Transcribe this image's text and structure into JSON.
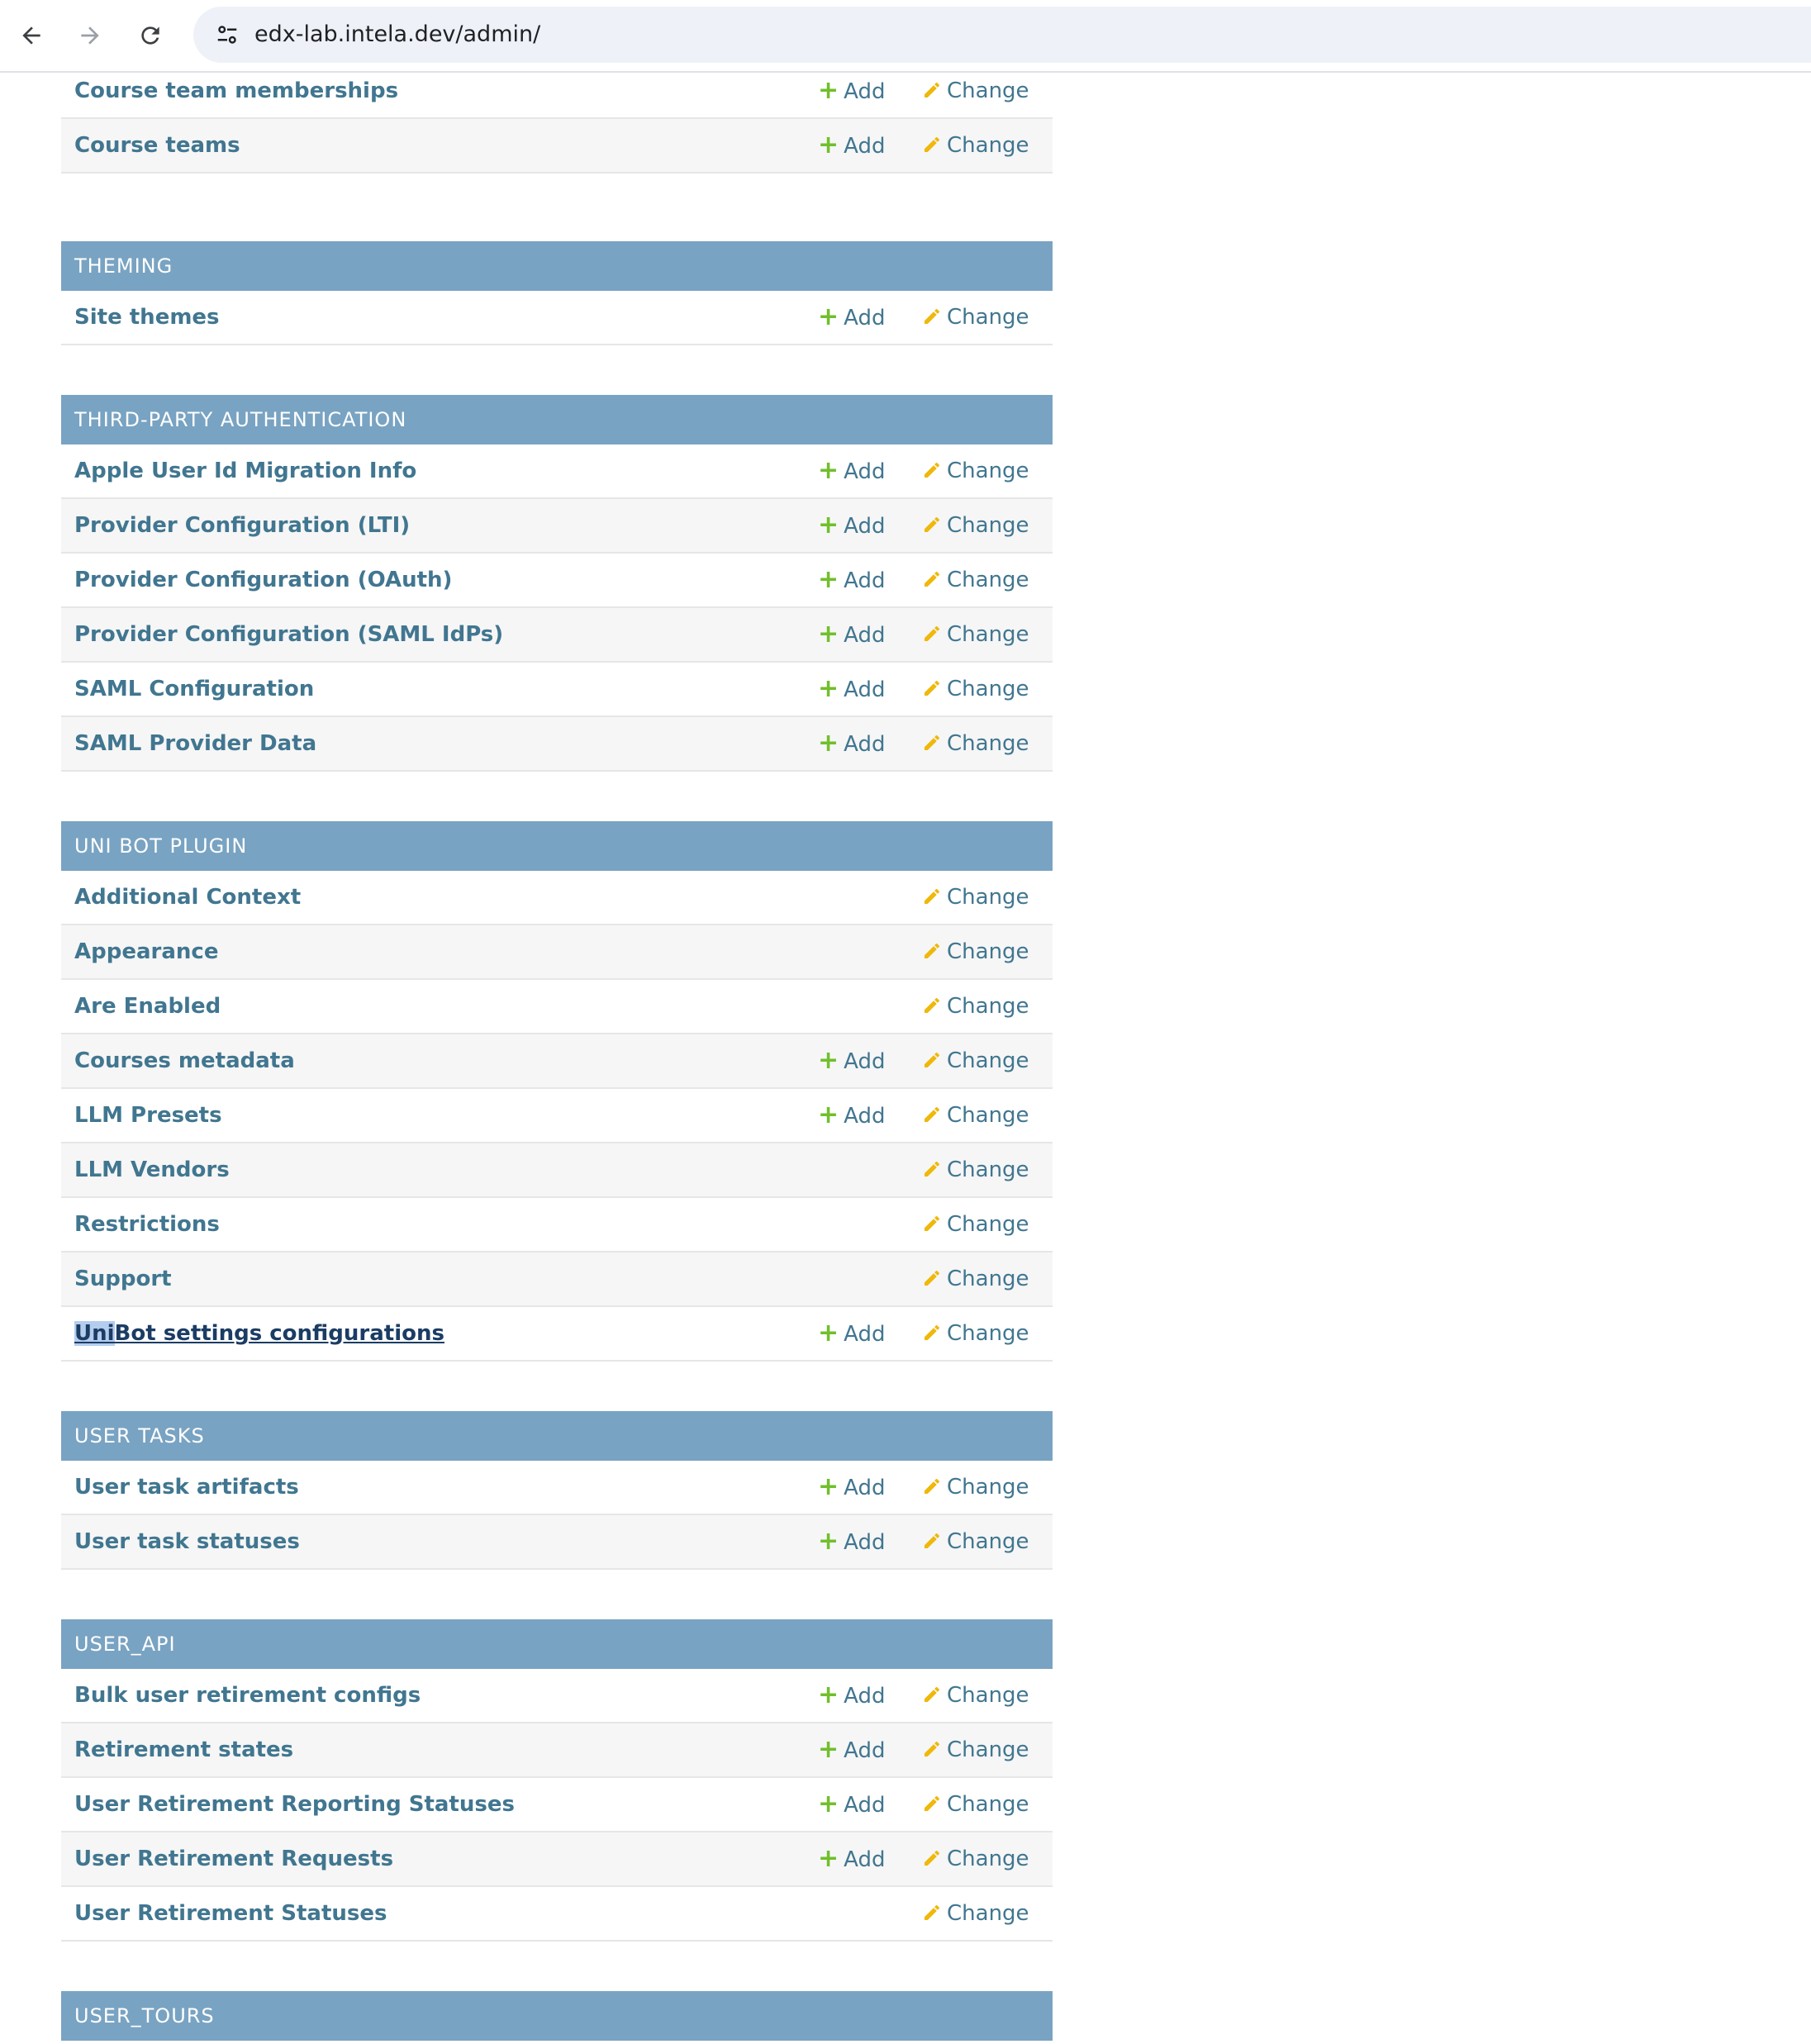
{
  "browser": {
    "url": "edx-lab.intela.dev/admin/",
    "back_icon": "arrow-left-icon",
    "forward_icon": "arrow-right-icon",
    "reload_icon": "reload-icon",
    "site_info_icon": "tune-icon"
  },
  "labels": {
    "add": "Add",
    "change": "Change"
  },
  "colors": {
    "caption_bg": "#79a3c2",
    "link": "#417690",
    "add_icon": "#70bf2b",
    "change_icon": "#efb80b"
  },
  "modules": [
    {
      "name": "",
      "rows": [
        {
          "label": "Course team memberships",
          "add": true
        },
        {
          "label": "Course teams",
          "add": true
        }
      ]
    },
    {
      "name": "THEMING",
      "rows": [
        {
          "label": "Site themes",
          "add": true
        }
      ]
    },
    {
      "name": "THIRD-PARTY AUTHENTICATION",
      "rows": [
        {
          "label": "Apple User Id Migration Info",
          "add": true
        },
        {
          "label": "Provider Configuration (LTI)",
          "add": true
        },
        {
          "label": "Provider Configuration (OAuth)",
          "add": true
        },
        {
          "label": "Provider Configuration (SAML IdPs)",
          "add": true
        },
        {
          "label": "SAML Configuration",
          "add": true
        },
        {
          "label": "SAML Provider Data",
          "add": true
        }
      ]
    },
    {
      "name": "UNI BOT PLUGIN",
      "rows": [
        {
          "label": "Additional Context",
          "add": false
        },
        {
          "label": "Appearance",
          "add": false
        },
        {
          "label": "Are Enabled",
          "add": false
        },
        {
          "label": "Courses metadata",
          "add": true
        },
        {
          "label": "LLM Presets",
          "add": true
        },
        {
          "label": "LLM Vendors",
          "add": false
        },
        {
          "label": "Restrictions",
          "add": false
        },
        {
          "label": "Support",
          "add": false
        },
        {
          "label": "UniBot settings configurations",
          "add": true,
          "active": true,
          "highlight": "Uni"
        }
      ]
    },
    {
      "name": "USER TASKS",
      "rows": [
        {
          "label": "User task artifacts",
          "add": true
        },
        {
          "label": "User task statuses",
          "add": true
        }
      ]
    },
    {
      "name": "USER_API",
      "rows": [
        {
          "label": "Bulk user retirement configs",
          "add": true
        },
        {
          "label": "Retirement states",
          "add": true
        },
        {
          "label": "User Retirement Reporting Statuses",
          "add": true
        },
        {
          "label": "User Retirement Requests",
          "add": true
        },
        {
          "label": "User Retirement Statuses",
          "add": false
        }
      ]
    },
    {
      "name": "USER_TOURS",
      "rows": []
    }
  ]
}
